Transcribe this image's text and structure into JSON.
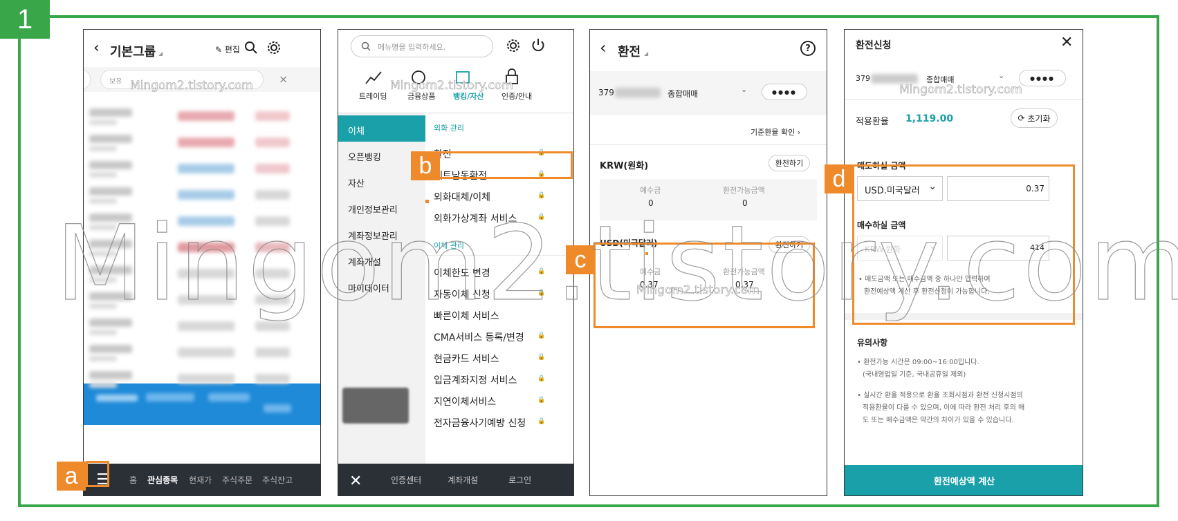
{
  "step_number": "1",
  "watermark": "Mingom2.tistory.com",
  "screen1": {
    "title": "기본그룹",
    "edit_label": "편집",
    "search_chip": "보유",
    "close_x": "×",
    "tabs": [
      "홈",
      "관심종목",
      "현재가",
      "주식주문",
      "주식잔고"
    ],
    "active_tab": "관심종목",
    "tag": "a"
  },
  "screen2": {
    "search_placeholder": "메뉴명을 입력하세요.",
    "top_menu": [
      "트레이딩",
      "금융상품",
      "뱅킹/자산",
      "인증/안내"
    ],
    "categories": [
      "이체",
      "오픈뱅킹",
      "자산",
      "개인정보관리",
      "계좌정보관리",
      "계좌개설",
      "마이데이터"
    ],
    "section1": "외화 관리",
    "items1": [
      "환전",
      "베트남동환전",
      "외화대체/이체",
      "외화가상계좌 서비스"
    ],
    "section2": "이체 관리",
    "items2": [
      "이체한도 변경",
      "자동이체 신청",
      "빠른이체 서비스",
      "CMA서비스 등록/변경",
      "현금카드 서비스",
      "입금계좌지정 서비스",
      "지연이체서비스",
      "전자금융사기예방 신청"
    ],
    "bottom": [
      "인증센터",
      "계좌개설",
      "로그인"
    ],
    "tag": "b"
  },
  "screen3": {
    "title": "환전",
    "account_prefix": "379",
    "account_type": "종합매매",
    "password_dots": "●●●●",
    "rate_link": "기준환율 확인",
    "krw_title": "KRW(원화)",
    "exchange_btn": "환전하기",
    "deposit_label": "예수금",
    "available_label": "환전가능금액",
    "krw_deposit": "0",
    "krw_available": "0",
    "usd_title": "USD(미국달러)",
    "usd_deposit": "0.37",
    "usd_available": "0.37",
    "tag": "c"
  },
  "screen4": {
    "title": "환전신청",
    "account_prefix": "379",
    "account_type": "종합매매",
    "password_dots": "●●●●",
    "rate_label": "적용환율",
    "rate_value": "1,119.00",
    "reset_btn": "초기화",
    "sell_label": "매도하실 금액",
    "sell_currency": "USD.미국달러",
    "sell_amount": "0.37",
    "buy_label": "매수하실 금액",
    "buy_currency": "KRW.원화",
    "buy_amount": "414",
    "note_line1": "매도금액 또는 매수금액 중 하나만 입력하여",
    "note_line2": "환전예상액 계산 후 환전신청이 가능합니다.",
    "caution_title": "유의사항",
    "caution1_line1": "환전가능 시간은 09:00~16:00입니다.",
    "caution1_line2": "(국내영업일 기준, 국내공휴일 제외)",
    "caution2_line1": "실시간 환율 적용으로 환율 조회시점과 환전 신청시점의",
    "caution2_line2": "적용환율이 다를 수 있으며, 이에 따라 환전 처리 후의 매",
    "caution2_line3": "도 또는 매수금액은 약간의 차이가 있을 수 있습니다.",
    "calc_btn": "환전예상액 계산",
    "tag": "d"
  }
}
